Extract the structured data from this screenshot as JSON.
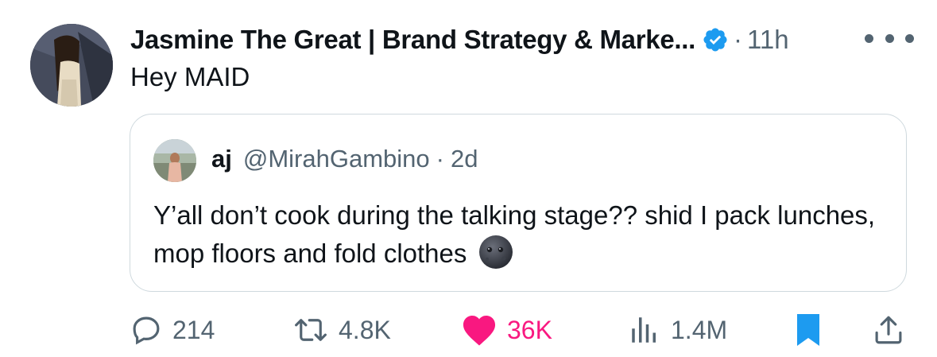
{
  "tweet": {
    "author_name": "Jasmine The Great | Brand Strategy & Marke...",
    "separator": "·",
    "time": "11h",
    "text": "Hey MAID",
    "verified": true
  },
  "quoted_tweet": {
    "name": "aj",
    "handle": "@MirahGambino",
    "separator": "·",
    "time": "2d",
    "text": "Y’all don’t cook during the talking stage?? shid I pack lunches, mop floors and fold clothes",
    "emoji": "new-moon-face"
  },
  "actions": {
    "replies": "214",
    "reposts": "4.8K",
    "likes": "36K",
    "views": "1.4M"
  },
  "colors": {
    "verified_blue": "#1d9bf0",
    "like_pink": "#f91880",
    "bookmark_blue": "#1d9bf0",
    "muted_text": "#536471"
  }
}
